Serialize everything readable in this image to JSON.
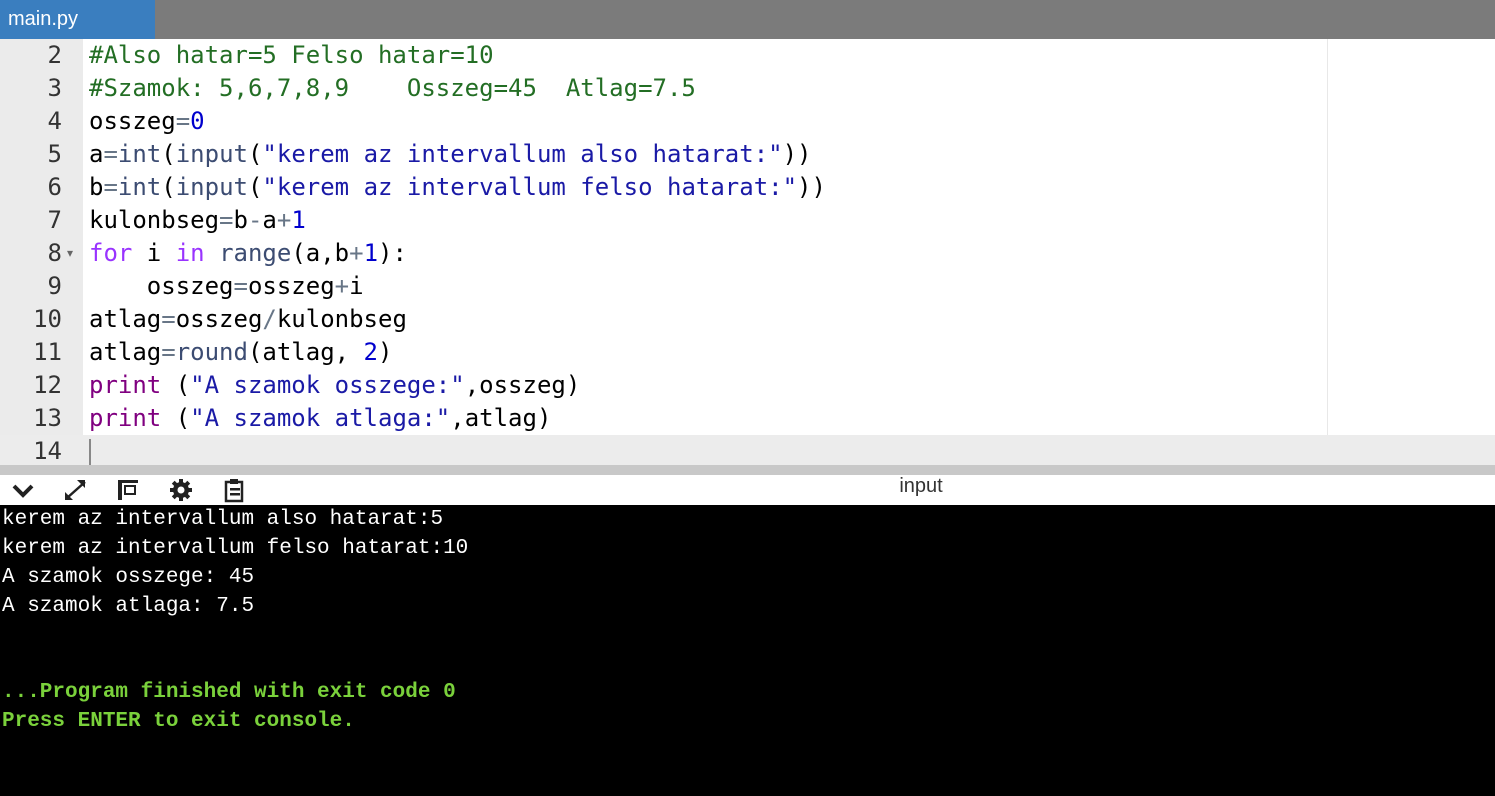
{
  "tab": {
    "label": "main.py"
  },
  "editor": {
    "lines": [
      {
        "n": "2",
        "text": "#Also hatar=5 Felso hatar=10"
      },
      {
        "n": "3",
        "text": "#Szamok: 5,6,7,8,9    Osszeg=45  Atlag=7.5"
      },
      {
        "n": "4",
        "text": "osszeg=0"
      },
      {
        "n": "5",
        "text": "a=int(input(\"kerem az intervallum also hatarat:\"))"
      },
      {
        "n": "6",
        "text": "b=int(input(\"kerem az intervallum felso hatarat:\"))"
      },
      {
        "n": "7",
        "text": "kulonbseg=b-a+1"
      },
      {
        "n": "8",
        "text": "for i in range(a,b+1):"
      },
      {
        "n": "9",
        "text": "    osszeg=osszeg+i"
      },
      {
        "n": "10",
        "text": "atlag=osszeg/kulonbseg"
      },
      {
        "n": "11",
        "text": "atlag=round(atlag, 2)"
      },
      {
        "n": "12",
        "text": "print (\"A szamok osszege:\",osszeg)"
      },
      {
        "n": "13",
        "text": "print (\"A szamok atlaga:\",atlag)"
      },
      {
        "n": "14",
        "text": ""
      }
    ]
  },
  "console_bar": {
    "title": "input",
    "icons": [
      "chevron-down-icon",
      "expand-icon",
      "layout-icon",
      "gear-icon",
      "clipboard-icon"
    ]
  },
  "console": {
    "output": [
      "kerem az intervallum also hatarat:5",
      "kerem az intervallum felso hatarat:10",
      "A szamok osszege: 45",
      "A szamok atlaga: 7.5"
    ],
    "status": [
      "...Program finished with exit code 0",
      "Press ENTER to exit console."
    ]
  },
  "colors": {
    "tab_active": "#3a7ebf",
    "tabbar": "#7b7b7b",
    "console_green": "#7ad13b",
    "comment": "#236e24"
  }
}
